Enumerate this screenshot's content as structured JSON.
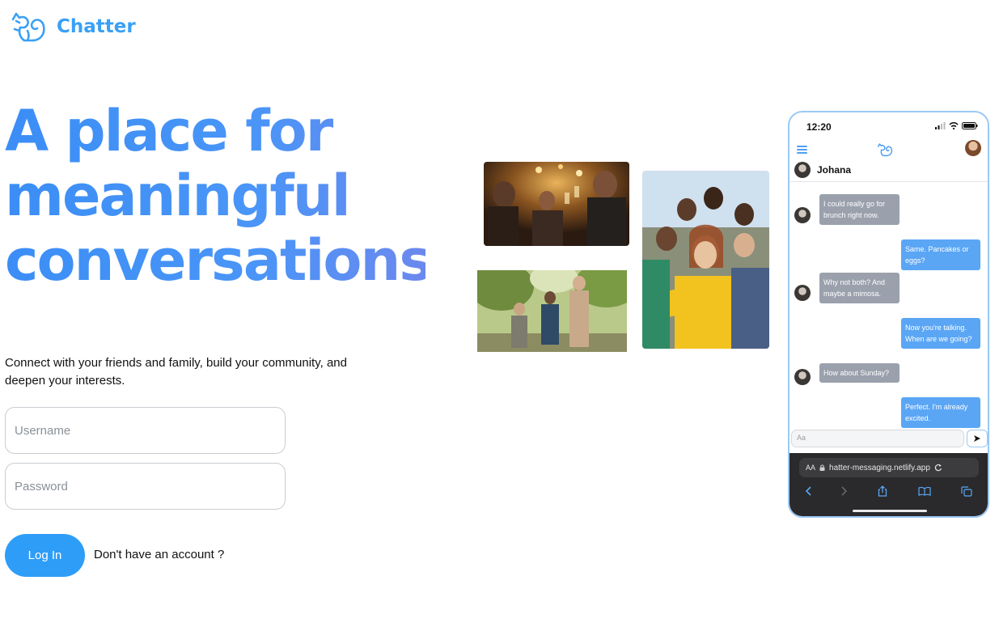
{
  "brand": {
    "name": "Chatter",
    "logo_icon": "squirrel-icon",
    "color": "#3aa0f5"
  },
  "hero": {
    "lines": [
      "A place for",
      "meaningful",
      "conversations"
    ]
  },
  "tagline": "Connect with your friends and family, build your community, and deepen your interests.",
  "login": {
    "username_placeholder": "Username",
    "password_placeholder": "Password",
    "login_label": "Log In",
    "signup_text": "Don't have an account ?",
    "button_color": "#2e9df7"
  },
  "photos": [
    {
      "name": "bar-toast-photo"
    },
    {
      "name": "hiking-friends-photo"
    },
    {
      "name": "group-selfie-photo"
    }
  ],
  "phone": {
    "time": "12:20",
    "contact_name": "Johana",
    "messages": [
      {
        "dir": "in",
        "text": "I could really go for brunch right now."
      },
      {
        "dir": "out",
        "text": "Same. Pancakes or eggs?"
      },
      {
        "dir": "in",
        "text": "Why not both? And maybe a mimosa."
      },
      {
        "dir": "out",
        "text": "Now you're talking. When are we going?"
      },
      {
        "dir": "in",
        "text": "How about Sunday?"
      },
      {
        "dir": "out",
        "text": "Perfect. I'm already excited."
      }
    ],
    "composer_placeholder": "Aa",
    "send_icon": "send-arrow-icon",
    "browser": {
      "aa": "AA",
      "url": "hatter-messaging.netlify.app"
    }
  }
}
